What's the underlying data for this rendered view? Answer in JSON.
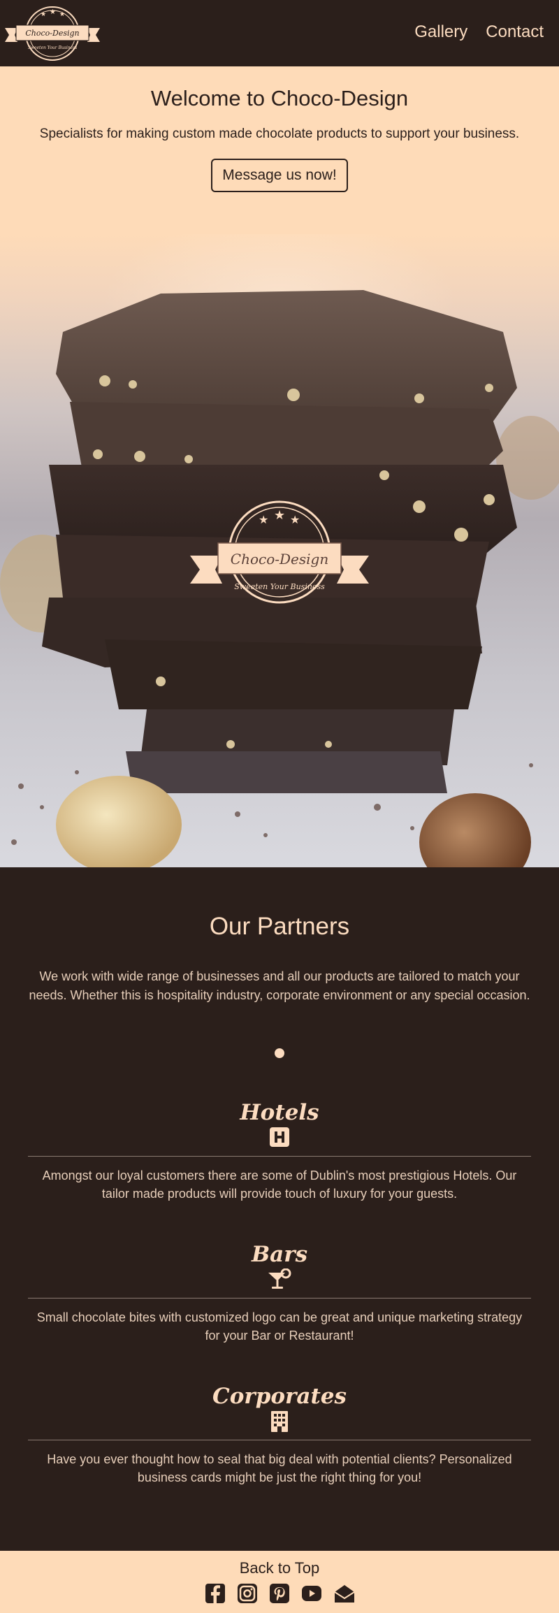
{
  "header": {
    "logo_title": "Choco-Design",
    "logo_tagline": "Sweeten Your Business",
    "nav": [
      {
        "label": "Gallery"
      },
      {
        "label": "Contact"
      }
    ]
  },
  "intro": {
    "title": "Welcome to Choco-Design",
    "subtitle": "Specialists for making custom made chocolate products to support your business.",
    "cta_label": "Message us now!"
  },
  "hero": {
    "logo_title": "Choco-Design",
    "logo_tagline": "Sweeten Your Business"
  },
  "partners": {
    "title": "Our Partners",
    "lead": "We work with wide range of businesses and all our products are tailored to match your needs. Whether this is hospitality industry, corporate environment or any special occasion.",
    "items": [
      {
        "title": "Hotels",
        "icon": "hotel-icon",
        "text": "Amongst our loyal customers there are some of Dublin's most prestigious Hotels. Our tailor made products will provide touch of luxury for your guests."
      },
      {
        "title": "Bars",
        "icon": "cocktail-icon",
        "text": "Small chocolate bites with customized logo can be great and unique marketing strategy for your Bar or Restaurant!"
      },
      {
        "title": "Corporates",
        "icon": "building-icon",
        "text": "Have you ever thought how to seal that big deal with potential clients? Personalized business cards might be just the right thing for you!"
      }
    ]
  },
  "footer": {
    "back_to_top": "Back to Top",
    "socials": [
      "facebook-icon",
      "instagram-icon",
      "pinterest-icon",
      "youtube-icon",
      "email-icon"
    ]
  },
  "colors": {
    "brand_dark": "#2b1f1b",
    "brand_light": "#fedbb8",
    "accent_text": "#fcdcc0"
  }
}
